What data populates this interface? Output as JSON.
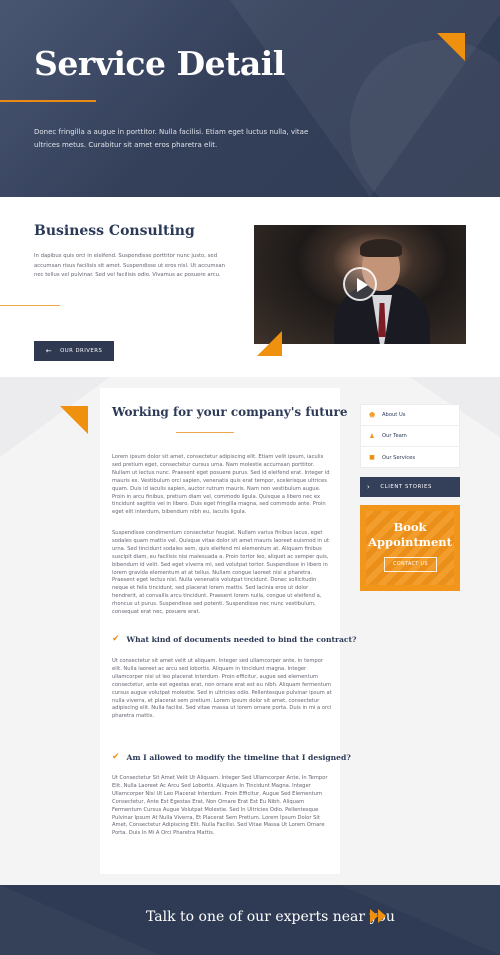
{
  "hero": {
    "title": "Service Detail",
    "text": "Donec fringilla a augue in porttitor. Nulla facilisi. Etiam eget luctus nulla, vitae ultrices metus. Curabitur sit amet eros pharetra elit."
  },
  "consulting": {
    "title": "Business Consulting",
    "text": "In dapibus quis orci in eleifend. Suspendisse porttitor nunc justo, sed accumsan risus facilisis sit amet. Suspendisse ut eros nisl. Ut accumsan nec tellus vel pulvinar. Sed vel facilisis odio. Vivamus ac posuere arcu.",
    "button_label": "OUR DRIVERS",
    "button_icon": "arrow-left-icon",
    "video_icon": "play-icon"
  },
  "main": {
    "title": "Working for your company's future",
    "paragraph1": "Lorem ipsum dolor sit amet, consectetur adipiscing elit. Etiam velit ipsum, iaculis sed pretium eget, consectetur cursus urna. Nam molestie accumsan porttitor. Nullam ut lectus nunc. Praesent eget posuere purus. Sed id eleifend erat. Integer id mauris ex. Vestibulum orci sapien, venenatis quis erat tempor, scelerisque ultrices quam. Duis id iaculis sapien, auctor rutrum mauris. Nam non vestibulum augue. Proin in arcu finibus, pretium diam vel, commodo ligula. Quisque a libero nec ex tincidunt sagittis vel in libero. Duis eget fringilla magna, sed commodo ante. Proin eget elit interdum, bibendum nibh eu, iaculis ligula.",
    "paragraph2": "Suspendisse condimentum consectetur feugiat. Nullam varius finibus lacus, eget sodales quam mattis vel. Quisque vitae dolor sit amet mauris laoreet euismod in ut urna. Sed tincidunt sodales sem, quis eleifend mi elementum at. Aliquam finibus suscipit diam, eu facilisis nisi malesuada a. Proin tortor leo, aliquet ac semper quis, bibendum id velit. Sed eget viverra mi, sed volutpat tortor. Suspendisse in libero in lorem gravida elementum at at tellus. Nullam congue laoreet nisi a pharetra. Praesent eget lectus nisl. Nulla venenatis volutpat tincidunt. Donec sollicitudin neque et felis tincidunt, sed placerat lorem mattis. Sed lacinia eros ut dolor hendrerit, at convallis arcu tincidunt. Praesent lorem nulla, congue ut eleifend a, rhoncus ut purus. Suspendisse sed potenti. Suspendisse nec nunc vestibulum, consequat erat nec, posuere erat.",
    "faq1_question": "What kind of documents needed to bind the contract?",
    "faq1_answer": "Ut consectetur sit amet velit ut aliquam. Integer sed ullamcorper ante, in tempor elit. Nulla laoreet ac arcu sed lobortis. Aliquam in tincidunt magna. Integer ullamcorper nisi ut leo placerat interdum. Proin efficitur, augue sed elementum consectetur, ante est egestas erat, non ornare erat est eu nibh. Aliquam fermentum cursus augue volutpat molestie. Sed in ultricies odio. Pellentesque pulvinar ipsum at nulla viverra, et placerat sem pretium. Lorem ipsum dolor sit amet, consectetur adipiscing elit. Nulla facilisi. Sed vitae massa ut lorem ornare porta. Duis in mi a orci pharetra mattis.",
    "faq2_question": "Am I allowed to modify the timeline that I designed?",
    "faq2_answer": "Ut Consectetur Sit Amet Velit Ut Aliquam. Integer Sed Ullamcorper Ante, In Tempor Elit. Nulla Laoreet Ac Arcu Sed Lobortis. Aliquam In Tincidunt Magna. Integer Ullamcorper Nisi Ut Leo Placerat Interdum. Proin Efficitur, Augue Sed Elementum Consectetur, Ante Est Egestas Erat, Non Ornare Erat Est Eu Nibh. Aliquam Fermentum Cursus Augue Volutpat Molestie. Sed In Ultricies Odio. Pellentesque Pulvinar Ipsum At Nulla Viverra, Et Placerat Sem Pretium. Lorem Ipsum Dolor Sit Amet, Consectetur Adipiscing Elit. Nulla Facilisi. Sed Vitae Massa Ut Lorem Ornare Porta. Duis In Mi A Orci Pharetra Mattis.",
    "check_icon": "check-icon"
  },
  "sidebar": {
    "items": [
      {
        "label": "About Us",
        "icon": "users-icon"
      },
      {
        "label": "Our Team",
        "icon": "person-icon"
      },
      {
        "label": "Our Services",
        "icon": "services-icon"
      }
    ],
    "stories_label": "CLIENT STORIES",
    "booking_title": "Book Appointment",
    "booking_button": "CONTACT US"
  },
  "cta": {
    "text": "Talk to one of our experts near you",
    "icon": "double-arrow-right-icon"
  },
  "colors": {
    "navy": "#34405a",
    "accent": "#f0900f",
    "background": "#f4f4f5"
  }
}
